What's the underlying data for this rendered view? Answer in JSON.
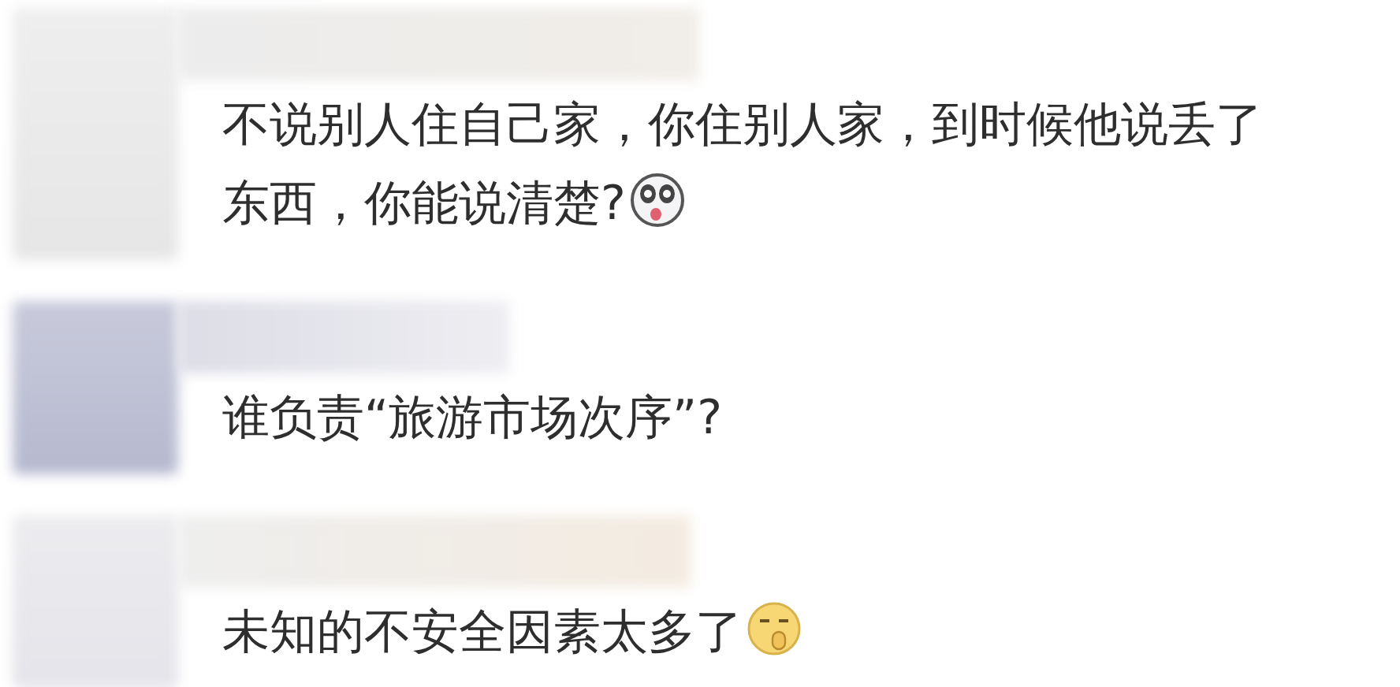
{
  "comments": [
    {
      "lines": [
        "不说别人住自己家，你住别人家，到时候他说丢了",
        "东西，你能说清楚?"
      ],
      "emoji": {
        "kind": "dog"
      }
    },
    {
      "lines": [
        "谁负责“旅游市场次序”?"
      ]
    },
    {
      "lines": [
        "未知的不安全因素太多了"
      ],
      "emoji": {
        "kind": "shush"
      }
    }
  ]
}
